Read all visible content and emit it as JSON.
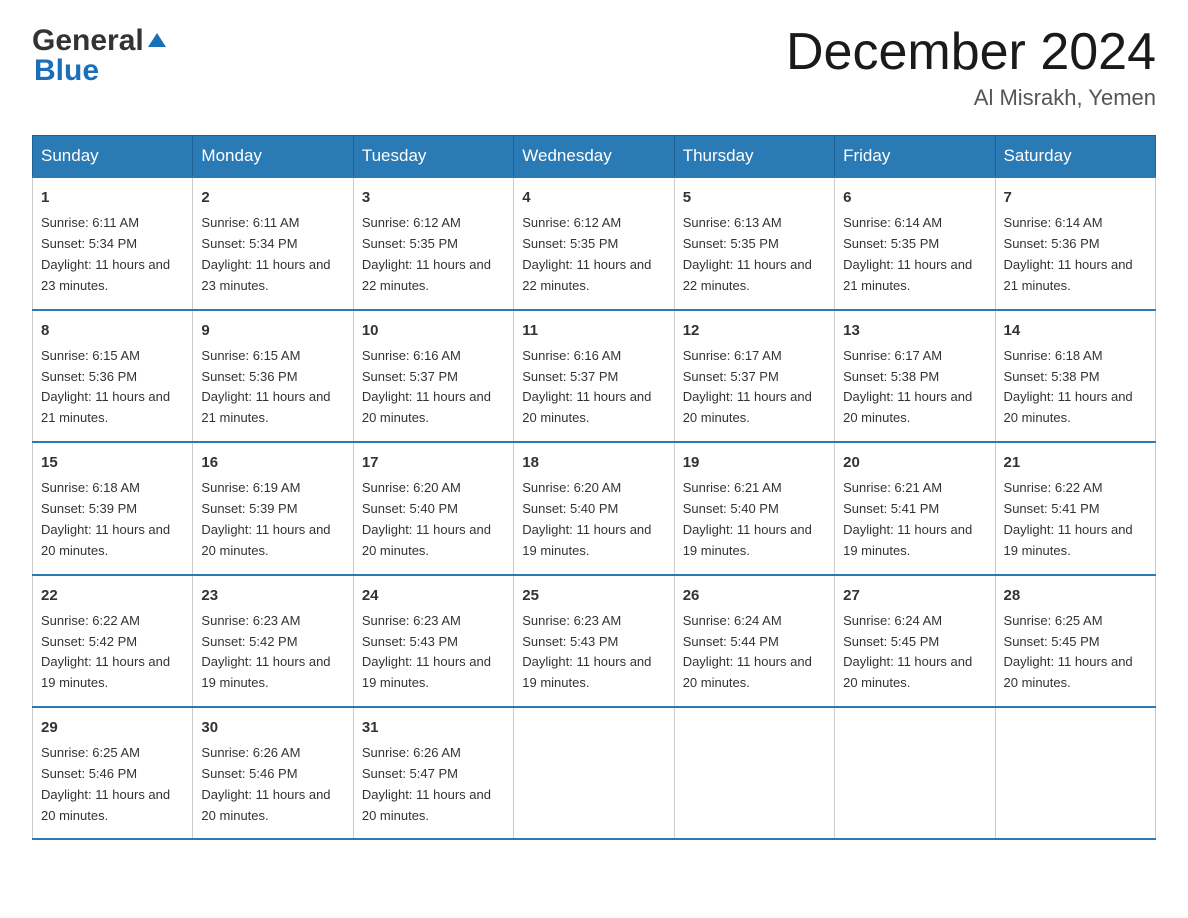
{
  "logo": {
    "general": "General",
    "blue": "Blue"
  },
  "header": {
    "month": "December 2024",
    "location": "Al Misrakh, Yemen"
  },
  "days_of_week": [
    "Sunday",
    "Monday",
    "Tuesday",
    "Wednesday",
    "Thursday",
    "Friday",
    "Saturday"
  ],
  "weeks": [
    [
      {
        "day": "1",
        "sunrise": "6:11 AM",
        "sunset": "5:34 PM",
        "daylight": "11 hours and 23 minutes."
      },
      {
        "day": "2",
        "sunrise": "6:11 AM",
        "sunset": "5:34 PM",
        "daylight": "11 hours and 23 minutes."
      },
      {
        "day": "3",
        "sunrise": "6:12 AM",
        "sunset": "5:35 PM",
        "daylight": "11 hours and 22 minutes."
      },
      {
        "day": "4",
        "sunrise": "6:12 AM",
        "sunset": "5:35 PM",
        "daylight": "11 hours and 22 minutes."
      },
      {
        "day": "5",
        "sunrise": "6:13 AM",
        "sunset": "5:35 PM",
        "daylight": "11 hours and 22 minutes."
      },
      {
        "day": "6",
        "sunrise": "6:14 AM",
        "sunset": "5:35 PM",
        "daylight": "11 hours and 21 minutes."
      },
      {
        "day": "7",
        "sunrise": "6:14 AM",
        "sunset": "5:36 PM",
        "daylight": "11 hours and 21 minutes."
      }
    ],
    [
      {
        "day": "8",
        "sunrise": "6:15 AM",
        "sunset": "5:36 PM",
        "daylight": "11 hours and 21 minutes."
      },
      {
        "day": "9",
        "sunrise": "6:15 AM",
        "sunset": "5:36 PM",
        "daylight": "11 hours and 21 minutes."
      },
      {
        "day": "10",
        "sunrise": "6:16 AM",
        "sunset": "5:37 PM",
        "daylight": "11 hours and 20 minutes."
      },
      {
        "day": "11",
        "sunrise": "6:16 AM",
        "sunset": "5:37 PM",
        "daylight": "11 hours and 20 minutes."
      },
      {
        "day": "12",
        "sunrise": "6:17 AM",
        "sunset": "5:37 PM",
        "daylight": "11 hours and 20 minutes."
      },
      {
        "day": "13",
        "sunrise": "6:17 AM",
        "sunset": "5:38 PM",
        "daylight": "11 hours and 20 minutes."
      },
      {
        "day": "14",
        "sunrise": "6:18 AM",
        "sunset": "5:38 PM",
        "daylight": "11 hours and 20 minutes."
      }
    ],
    [
      {
        "day": "15",
        "sunrise": "6:18 AM",
        "sunset": "5:39 PM",
        "daylight": "11 hours and 20 minutes."
      },
      {
        "day": "16",
        "sunrise": "6:19 AM",
        "sunset": "5:39 PM",
        "daylight": "11 hours and 20 minutes."
      },
      {
        "day": "17",
        "sunrise": "6:20 AM",
        "sunset": "5:40 PM",
        "daylight": "11 hours and 20 minutes."
      },
      {
        "day": "18",
        "sunrise": "6:20 AM",
        "sunset": "5:40 PM",
        "daylight": "11 hours and 19 minutes."
      },
      {
        "day": "19",
        "sunrise": "6:21 AM",
        "sunset": "5:40 PM",
        "daylight": "11 hours and 19 minutes."
      },
      {
        "day": "20",
        "sunrise": "6:21 AM",
        "sunset": "5:41 PM",
        "daylight": "11 hours and 19 minutes."
      },
      {
        "day": "21",
        "sunrise": "6:22 AM",
        "sunset": "5:41 PM",
        "daylight": "11 hours and 19 minutes."
      }
    ],
    [
      {
        "day": "22",
        "sunrise": "6:22 AM",
        "sunset": "5:42 PM",
        "daylight": "11 hours and 19 minutes."
      },
      {
        "day": "23",
        "sunrise": "6:23 AM",
        "sunset": "5:42 PM",
        "daylight": "11 hours and 19 minutes."
      },
      {
        "day": "24",
        "sunrise": "6:23 AM",
        "sunset": "5:43 PM",
        "daylight": "11 hours and 19 minutes."
      },
      {
        "day": "25",
        "sunrise": "6:23 AM",
        "sunset": "5:43 PM",
        "daylight": "11 hours and 19 minutes."
      },
      {
        "day": "26",
        "sunrise": "6:24 AM",
        "sunset": "5:44 PM",
        "daylight": "11 hours and 20 minutes."
      },
      {
        "day": "27",
        "sunrise": "6:24 AM",
        "sunset": "5:45 PM",
        "daylight": "11 hours and 20 minutes."
      },
      {
        "day": "28",
        "sunrise": "6:25 AM",
        "sunset": "5:45 PM",
        "daylight": "11 hours and 20 minutes."
      }
    ],
    [
      {
        "day": "29",
        "sunrise": "6:25 AM",
        "sunset": "5:46 PM",
        "daylight": "11 hours and 20 minutes."
      },
      {
        "day": "30",
        "sunrise": "6:26 AM",
        "sunset": "5:46 PM",
        "daylight": "11 hours and 20 minutes."
      },
      {
        "day": "31",
        "sunrise": "6:26 AM",
        "sunset": "5:47 PM",
        "daylight": "11 hours and 20 minutes."
      },
      null,
      null,
      null,
      null
    ]
  ],
  "labels": {
    "sunrise": "Sunrise:",
    "sunset": "Sunset:",
    "daylight": "Daylight:"
  }
}
